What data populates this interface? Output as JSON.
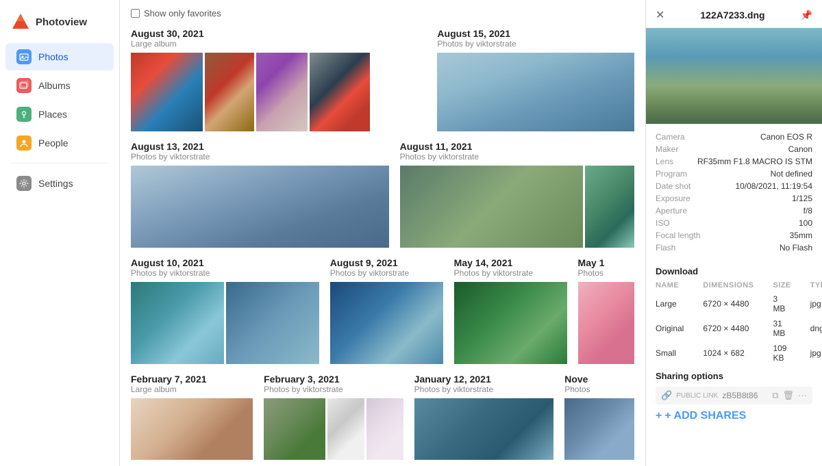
{
  "app": {
    "name": "Photoview",
    "logo_alt": "Photoview logo"
  },
  "sidebar": {
    "items": [
      {
        "id": "photos",
        "label": "Photos",
        "active": true
      },
      {
        "id": "albums",
        "label": "Albums",
        "active": false
      },
      {
        "id": "places",
        "label": "Places",
        "active": false
      },
      {
        "id": "people",
        "label": "People",
        "active": false
      },
      {
        "id": "settings",
        "label": "Settings",
        "active": false
      }
    ]
  },
  "favorites": {
    "checkbox_label": "Show only favorites"
  },
  "sections": [
    {
      "id": "aug30",
      "date": "August 30, 2021",
      "album": "Large album"
    },
    {
      "id": "aug15",
      "date": "August 15, 2021",
      "album": "Photos by viktorstrate"
    },
    {
      "id": "aug13",
      "date": "August 13, 2021",
      "album": "Photos by viktorstrate"
    },
    {
      "id": "aug11",
      "date": "August 11, 2021",
      "album": "Photos by viktorstrate"
    },
    {
      "id": "aug10",
      "date": "August 10, 2021",
      "album": "Photos by viktorstrate"
    },
    {
      "id": "aug9",
      "date": "August 9, 2021",
      "album": "Photos by viktorstrate"
    },
    {
      "id": "may14",
      "date": "May 14, 2021",
      "album": "Photos by viktorstrate"
    },
    {
      "id": "may1",
      "date": "May 1",
      "album": "Photos"
    },
    {
      "id": "feb7",
      "date": "February 7, 2021",
      "album": "Large album"
    },
    {
      "id": "feb3",
      "date": "February 3, 2021",
      "album": "Photos by viktorstrate"
    },
    {
      "id": "jan12",
      "date": "January 12, 2021",
      "album": "Photos by viktorstrate"
    },
    {
      "id": "nov",
      "date": "Nove",
      "album": "Photos"
    }
  ],
  "right_panel": {
    "filename": "122A7233.dng",
    "meta": [
      {
        "label": "Camera",
        "value": "Canon EOS R"
      },
      {
        "label": "Maker",
        "value": "Canon"
      },
      {
        "label": "Lens",
        "value": "RF35mm F1.8 MACRO IS STM"
      },
      {
        "label": "Program",
        "value": "Not defined"
      },
      {
        "label": "Date shot",
        "value": "10/08/2021, 11:19:54"
      },
      {
        "label": "Exposure",
        "value": "1/125"
      },
      {
        "label": "Aperture",
        "value": "f/8"
      },
      {
        "label": "ISO",
        "value": "100"
      },
      {
        "label": "Focal length",
        "value": "35mm"
      },
      {
        "label": "Flash",
        "value": "No Flash"
      }
    ],
    "download": {
      "title": "Download",
      "columns": [
        "NAME",
        "DIMENSIONS",
        "SIZE",
        "TYPE"
      ],
      "rows": [
        {
          "name": "Large",
          "dimensions": "6720 × 4480",
          "size": "3 MB",
          "type": "jpg"
        },
        {
          "name": "Original",
          "dimensions": "6720 × 4480",
          "size": "31 MB",
          "type": "dng"
        },
        {
          "name": "Small",
          "dimensions": "1024 × 682",
          "size": "109 KB",
          "type": "jpg"
        }
      ]
    },
    "sharing": {
      "title": "Sharing options",
      "public_link_label": "PUBLIC LINK",
      "public_link_value": "zB5B8t86",
      "add_shares_label": "+ ADD SHARES"
    }
  }
}
